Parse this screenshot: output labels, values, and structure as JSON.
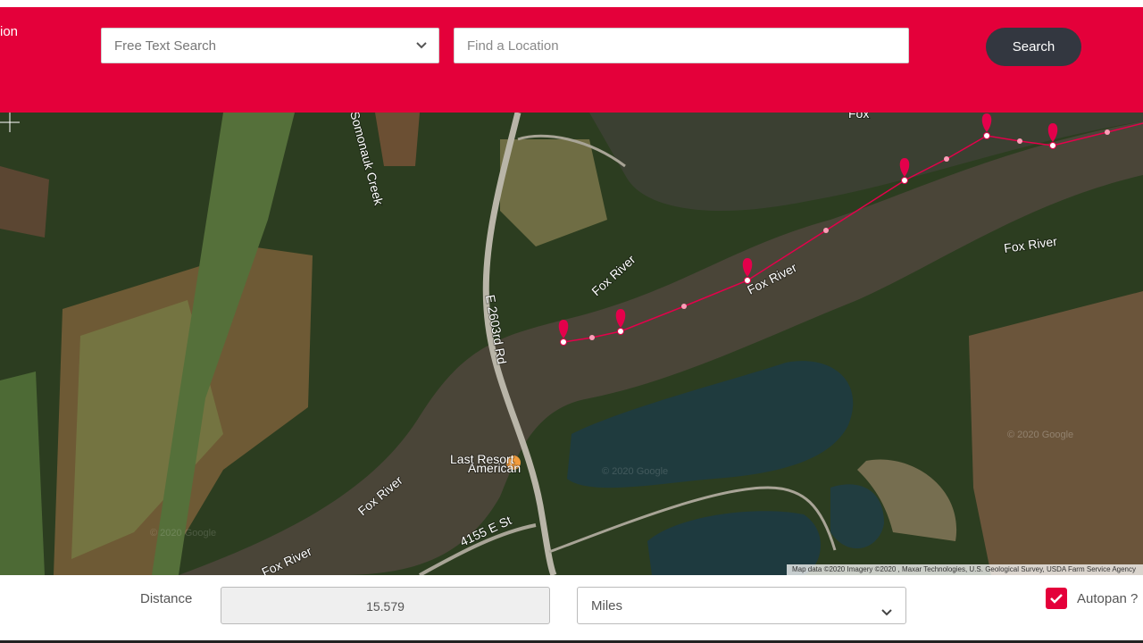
{
  "header": {
    "cut_title": "ion",
    "free_text_search": {
      "value": "Free Text Search"
    },
    "find_location": {
      "placeholder": "Find a Location"
    },
    "search_label": "Search"
  },
  "map": {
    "labels": {
      "creek": "Somonauk Creek",
      "road": "E 2603rd Rd",
      "fox_river_1": "Fox River",
      "fox_river_2": "Fox River",
      "fox_river_3": "Fox River",
      "fox_river_4": "Fox River",
      "fox_river_5": "Fox River",
      "fox_top": "Fox",
      "street": "4155 E St",
      "poi_name": "Last Resort",
      "poi_type": "American",
      "watermark_1": "© 2020 Google",
      "watermark_2": "© 2020 Google",
      "watermark_3": "© 2020 Google"
    },
    "attribution": "Map data ©2020 Imagery ©2020 , Maxar Technologies, U.S. Geological Survey, USDA Farm Service Agency",
    "route_color": "#e4004b"
  },
  "footer": {
    "distance_label": "Distance",
    "distance_value": "15.579",
    "units_value": "Miles",
    "autopan_label": "Autopan ?",
    "autopan_checked": true
  },
  "colors": {
    "brand": "#e4003a",
    "button_dark": "#333740"
  }
}
